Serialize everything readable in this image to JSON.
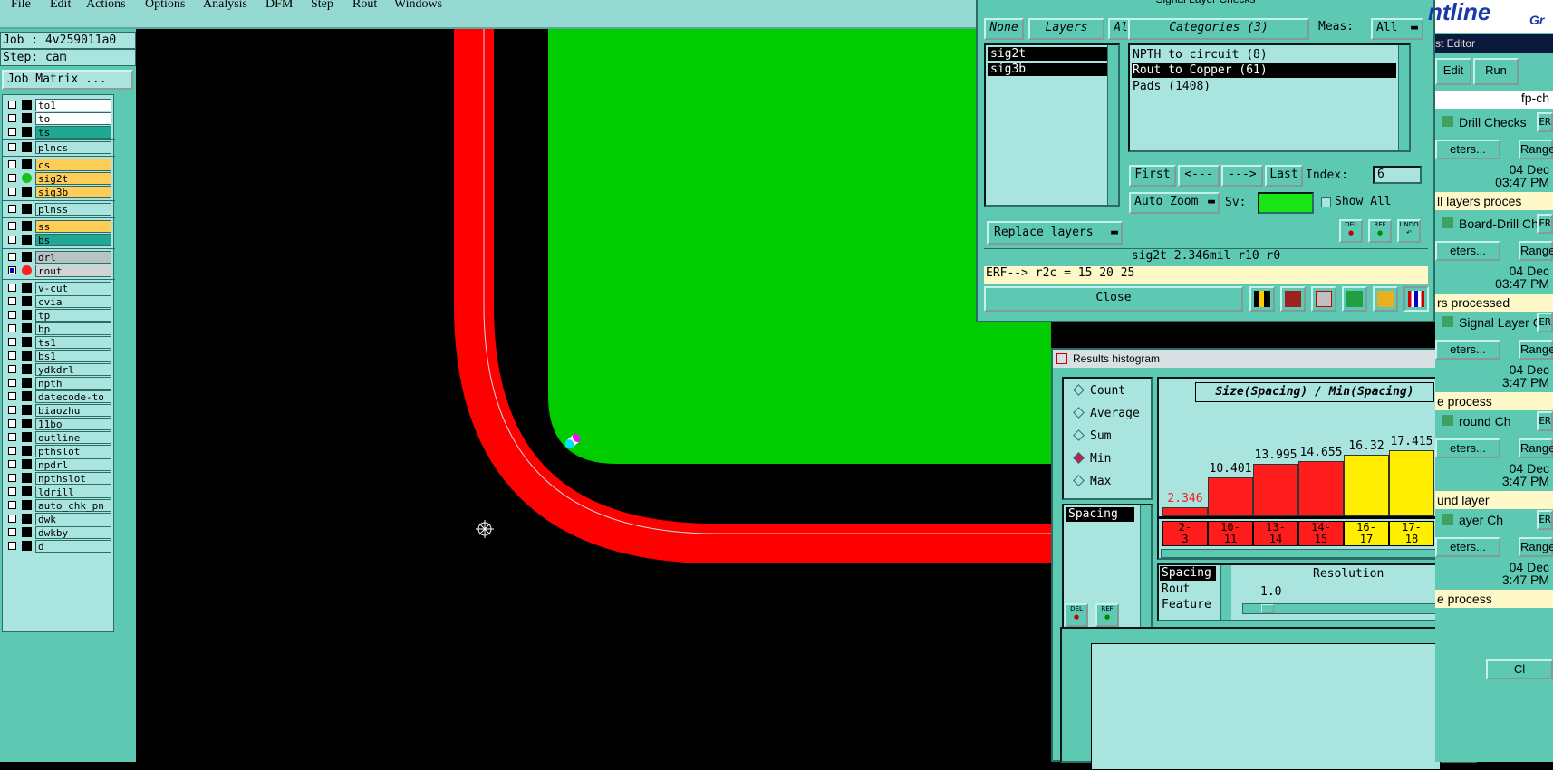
{
  "menu": [
    "File",
    "Edit",
    "Actions",
    "Options",
    "Analysis",
    "DFM",
    "Step",
    "Rout",
    "Windows"
  ],
  "job": {
    "job_label": "Job : 4v259011a0",
    "step_label": "Step: cam",
    "job_matrix": "Job Matrix ..."
  },
  "layers": [
    {
      "name": "to1",
      "color": "#ffffff"
    },
    {
      "name": "to",
      "color": "#ffffff"
    },
    {
      "name": "ts",
      "color": "#1fa893"
    },
    {
      "name": "plncs",
      "color": "#a9e4df"
    },
    {
      "name": "cs",
      "color": "#ffcc55"
    },
    {
      "name": "sig2t",
      "color": "#ffcc55",
      "dot": "#19c419"
    },
    {
      "name": "sig3b",
      "color": "#ffcc55"
    },
    {
      "name": "plnss",
      "color": "#a9e4df"
    },
    {
      "name": "ss",
      "color": "#ffcc55"
    },
    {
      "name": "bs",
      "color": "#1fa893"
    },
    {
      "name": "drl",
      "color": "#b8c4c4"
    },
    {
      "name": "rout",
      "color": "#d0d4d4",
      "dot": "#ff2020"
    },
    {
      "name": "v-cut",
      "color": "#a9e4df"
    },
    {
      "name": "cvia",
      "color": "#a9e4df"
    },
    {
      "name": "tp",
      "color": "#a9e4df"
    },
    {
      "name": "bp",
      "color": "#a9e4df"
    },
    {
      "name": "ts1",
      "color": "#a9e4df"
    },
    {
      "name": "bs1",
      "color": "#a9e4df"
    },
    {
      "name": "ydkdrl",
      "color": "#a9e4df"
    },
    {
      "name": "npth",
      "color": "#a9e4df"
    },
    {
      "name": "datecode-to",
      "color": "#a9e4df"
    },
    {
      "name": "biaozhu",
      "color": "#a9e4df"
    },
    {
      "name": "11bo",
      "color": "#a9e4df"
    },
    {
      "name": "outline",
      "color": "#a9e4df"
    },
    {
      "name": "pthslot",
      "color": "#a9e4df"
    },
    {
      "name": "npdrl",
      "color": "#a9e4df"
    },
    {
      "name": "npthslot",
      "color": "#a9e4df"
    },
    {
      "name": "ldrill",
      "color": "#a9e4df"
    },
    {
      "name": "auto_chk_pn",
      "color": "#a9e4df"
    },
    {
      "name": "dwk",
      "color": "#a9e4df"
    },
    {
      "name": "dwkby",
      "color": "#a9e4df"
    },
    {
      "name": "d",
      "color": "#a9e4df"
    }
  ],
  "signal_window": {
    "title": "Signal Layer Checks",
    "none_btn": "None",
    "layers_btn": "Layers",
    "all_btn": "All",
    "layer_items": [
      "sig2t",
      "sig3b"
    ],
    "categories_btn": "Categories (3)",
    "meas_label": "Meas:",
    "meas_value": "All",
    "categories": [
      "NPTH to circuit (8)",
      "Rout to Copper (61)",
      "Pads (1408)"
    ],
    "first": "First",
    "prev": "<---",
    "next": "--->",
    "last": "Last",
    "index_label": "Index:",
    "index_value": "6",
    "auto_zoom": "Auto Zoom",
    "sv_label": "Sv:",
    "show_all": "Show All",
    "replace_layers": "Replace layers",
    "del": "DEL",
    "ref": "REF",
    "undo": "UNDO",
    "status": "sig2t 2.346mil  r10  r0",
    "erf": "ERF--> r2c = 15 20 25",
    "close": "Close"
  },
  "histogram": {
    "title": "Results histogram",
    "modes": [
      "Count",
      "Average",
      "Sum",
      "Min",
      "Max"
    ],
    "selected_mode": "Min",
    "measure_list": [
      "Spacing"
    ],
    "chart_title": "Size(Spacing) / Min(Spacing)",
    "bars": [
      {
        "label": "2.346",
        "value": 2.346,
        "bin": "2-\n3",
        "color": "#ff1c1c"
      },
      {
        "label": "10.401",
        "value": 10.401,
        "bin": "10-\n11",
        "color": "#ff1c1c"
      },
      {
        "label": "13.995",
        "value": 13.995,
        "bin": "13-\n14",
        "color": "#ff1c1c"
      },
      {
        "label": "14.655",
        "value": 14.655,
        "bin": "14-\n15",
        "color": "#ff1c1c"
      },
      {
        "label": "16.32",
        "value": 16.32,
        "bin": "16-\n17",
        "color": "#ffee00"
      },
      {
        "label": "17.415",
        "value": 17.415,
        "bin": "17-\n18",
        "color": "#ffee00"
      }
    ],
    "bins": [
      "2-\n3",
      "10-\n11",
      "13-\n14",
      "14-\n15",
      "16-\n17",
      "17-\n18"
    ],
    "attr_list": [
      "Spacing",
      "Rout",
      "Feature"
    ],
    "resolution_label": "Resolution",
    "resolution_value": "1.0",
    "del": "DEL",
    "ref": "REF"
  },
  "right_panel": {
    "logo": "ntline",
    "logo2": "Gr",
    "editor": "st Editor",
    "edit": "Edit",
    "run": "Run",
    "fp": "fp-ch",
    "items": [
      {
        "label": "Drill Checks",
        "date": "04 Dec",
        "time": "03:47 PM",
        "status": "ll layers proces"
      },
      {
        "label": "Board-Drill Che",
        "date": "04 Dec",
        "time": "03:47 PM",
        "status": "rs processed"
      },
      {
        "label": "Signal Layer Ch",
        "date": "04 Dec",
        "time": "3:47 PM",
        "status": "e process"
      },
      {
        "label": "round Ch",
        "date": "04 Dec",
        "time": "3:47 PM",
        "status": "und layer"
      },
      {
        "label": "ayer Ch",
        "date": "04 Dec",
        "time": "3:47 PM",
        "status": "e process"
      }
    ],
    "params": "eters...",
    "range": "Range",
    "er": "ER",
    "cl": "Cl"
  }
}
